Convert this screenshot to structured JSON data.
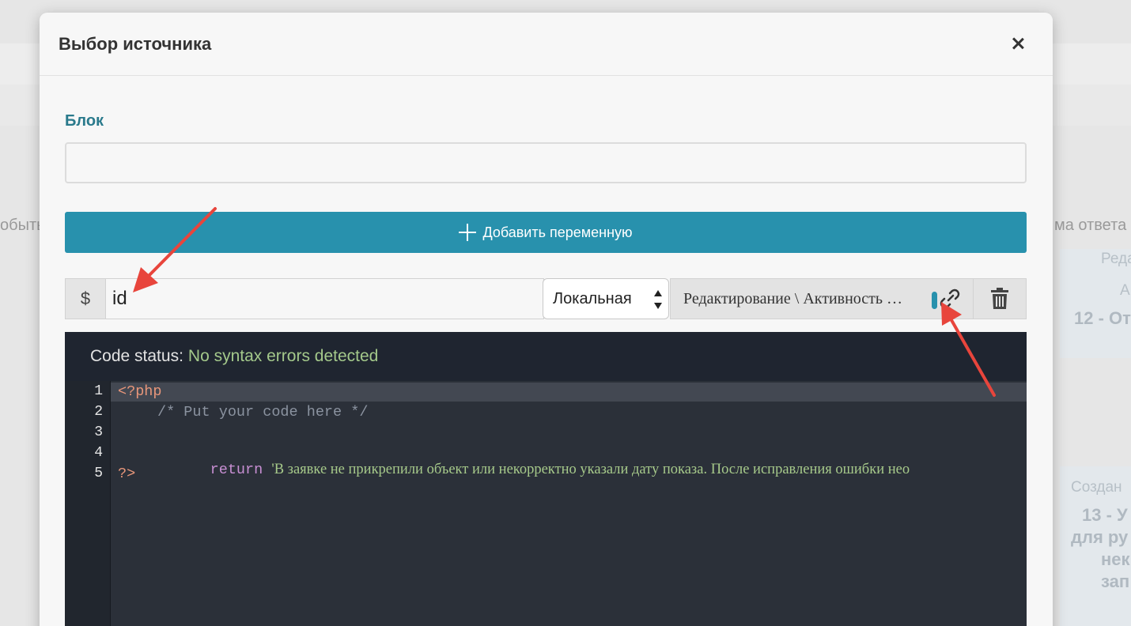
{
  "background": {
    "left_fragment": "обыть",
    "right_header": "ма ответа",
    "card1": {
      "line1": "Реда",
      "line2": "А",
      "title": "12 - От"
    },
    "card2": {
      "line1": "Создан",
      "title": [
        "13 - У",
        "для ру",
        "нек",
        "зап"
      ]
    }
  },
  "modal": {
    "title": "Выбор источника",
    "block_label": "Блок",
    "block_value": "",
    "add_variable_label": "Добавить переменную",
    "variable": {
      "prefix": "$",
      "name": "id",
      "scope": "Локальная",
      "source": "Редактирование \\ Активность …"
    },
    "code_status_label": "Code status:",
    "code_status_value": "No syntax errors detected",
    "code": {
      "line_numbers": [
        "1",
        "2",
        "3",
        "4",
        "5"
      ],
      "open_tag": "<?php",
      "comment": "/* Put your code here */",
      "keyword": "return",
      "string": "'В заявке не прикрепили объект или некорректно указали дату показа. После исправления ошибки нео",
      "close_tag": "?>"
    }
  },
  "colors": {
    "accent": "#2891ad",
    "label": "#2a7a8c",
    "editor_bg": "#2b3039",
    "status_ok": "#a4c98b",
    "annotation_arrow": "#e8453c"
  },
  "icons": [
    "close-icon",
    "plus-icon",
    "link-icon",
    "trash-icon"
  ]
}
